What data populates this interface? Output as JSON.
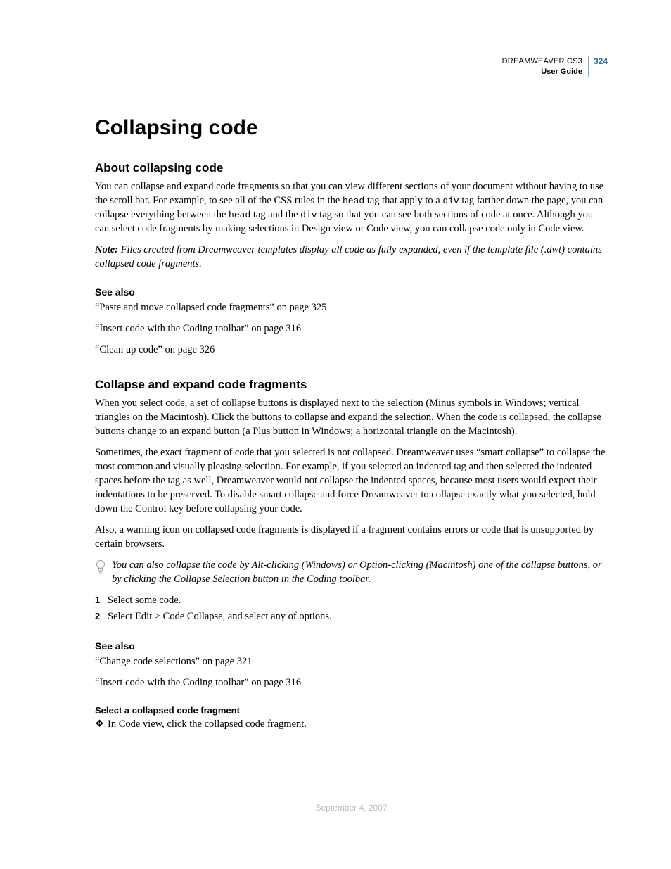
{
  "header": {
    "product": "DREAMWEAVER CS3",
    "guide": "User Guide",
    "page": "324"
  },
  "chapter_title": "Collapsing code",
  "section1": {
    "heading": "About collapsing code",
    "p1a": "You can collapse and expand code fragments so that you can view different sections of your document without having to use the scroll bar. For example, to see all of the CSS rules in the ",
    "code1": "head",
    "p1b": " tag that apply to a ",
    "code2": "div",
    "p1c": " tag farther down the page, you can collapse everything between the ",
    "code3": "head",
    "p1d": " tag and the ",
    "code4": "div",
    "p1e": " tag so that you can see both sections of code at once. Although you can select code fragments by making selections in Design view or Code view, you can collapse code only in Code view.",
    "note_label": "Note:",
    "note_body": " Files created from Dreamweaver templates display all code as fully expanded, even if the template file (.dwt) contains collapsed code fragments.",
    "see_also_heading": "See also",
    "xrefs": [
      "“Paste and move collapsed code fragments” on page 325",
      "“Insert code with the Coding toolbar” on page 316",
      "“Clean up code” on page 326"
    ]
  },
  "section2": {
    "heading": "Collapse and expand code fragments",
    "p1": "When you select code, a set of collapse buttons is displayed next to the selection (Minus symbols in Windows; vertical triangles on the Macintosh). Click the buttons to collapse and expand the selection. When the code is collapsed, the collapse buttons change to an expand button (a Plus button in Windows; a horizontal triangle on the Macintosh).",
    "p2": "Sometimes, the exact fragment of code that you selected is not collapsed. Dreamweaver uses “smart collapse” to collapse the most common and visually pleasing selection. For example, if you selected an indented tag and then selected the indented spaces before the tag as well, Dreamweaver would not collapse the indented spaces, because most users would expect their indentations to be preserved. To disable smart collapse and force Dreamweaver to collapse exactly what you selected, hold down the Control key before collapsing your code.",
    "p3": "Also, a warning icon on collapsed code fragments is displayed if a fragment contains errors or code that is unsupported by certain browsers.",
    "tip": "You can also collapse the code by Alt-clicking (Windows) or Option-clicking (Macintosh) one of the collapse buttons, or by clicking the Collapse Selection button in the Coding toolbar.",
    "steps": [
      "Select some code.",
      "Select Edit > Code Collapse, and select any of options."
    ],
    "see_also_heading": "See also",
    "xrefs": [
      "“Change code selections” on page 321",
      "“Insert code with the Coding toolbar” on page 316"
    ],
    "sub_heading": "Select a collapsed code fragment",
    "sub_bullet": "In Code view, click the collapsed code fragment."
  },
  "footer_date": "September 4, 2007"
}
